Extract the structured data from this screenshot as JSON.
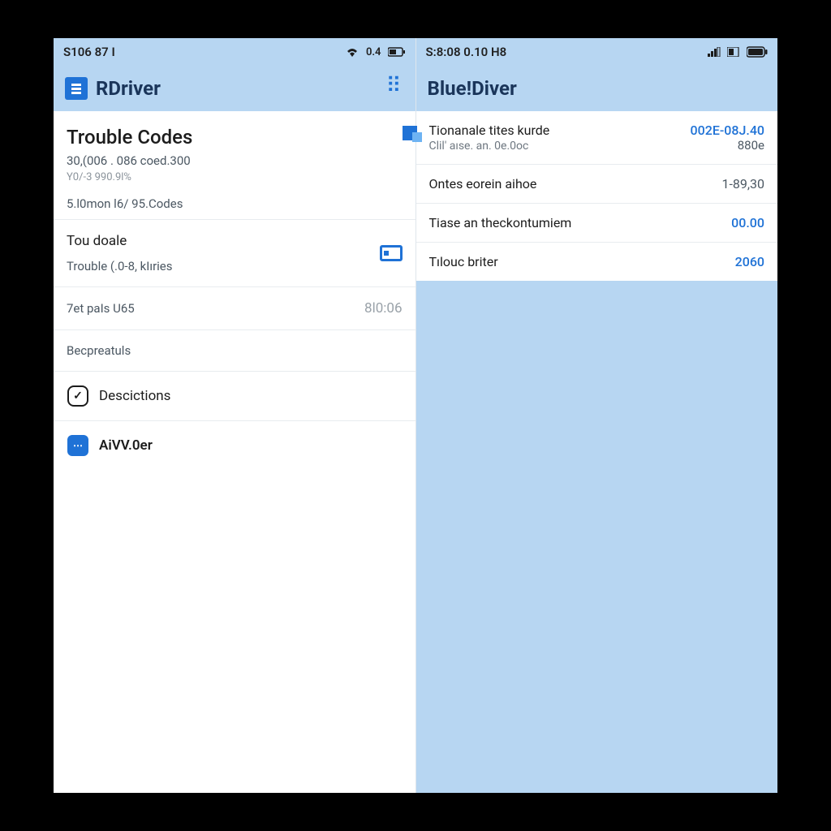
{
  "left": {
    "status": {
      "left": "S106 87  I",
      "wifi": "0.4"
    },
    "app": {
      "title": "RDriver"
    },
    "header": {
      "title": "Trouble Codes",
      "sub1": "30,(006 . 086 coed.300",
      "sub2": "Y0/-3 990.9l%",
      "sub3": "5.l0mon l6/ 95.Codes"
    },
    "items": {
      "toudoale": {
        "label": "Tou doale",
        "sub": "Trouble (.0-8, kIıries"
      },
      "tetpals": {
        "label": "7et paIs U65",
        "value": "8l0:06"
      },
      "becpreatuls": {
        "label": "Becpreatuls"
      },
      "descictions": {
        "label": "Descictions"
      },
      "aivoer": {
        "label": "AiVV.0er"
      }
    }
  },
  "right": {
    "status": {
      "left": "S:8:08  0.10  H8"
    },
    "app": {
      "title": "Blue!Diver"
    },
    "items": {
      "tionanale": {
        "label": "Tionanale tites kurde",
        "sub": "Clil' aıse. an. 0e.0oc",
        "value": "002E-08J.40",
        "value2": "880e"
      },
      "ontes": {
        "label": "Ontes eorein aihoe",
        "value": "1-89,30"
      },
      "tiase": {
        "label": "Tiase an theckontumiem",
        "value": "00.00"
      },
      "tilouc": {
        "label": "Tılouc briter",
        "value": "2060"
      }
    }
  }
}
